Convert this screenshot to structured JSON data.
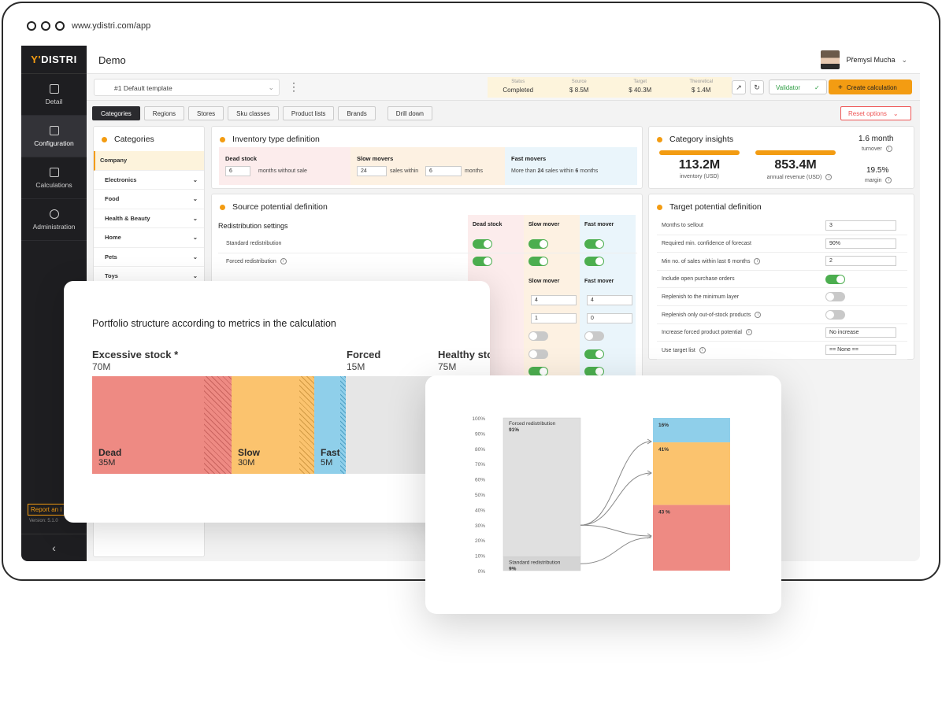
{
  "browser": {
    "url": "www.ydistri.com/app"
  },
  "sidebar": {
    "logo_prefix": "Y'",
    "logo_rest": "DISTRI",
    "items": [
      {
        "label": "Detail"
      },
      {
        "label": "Configuration"
      },
      {
        "label": "Calculations"
      },
      {
        "label": "Administration"
      }
    ],
    "report_label": "Report an i",
    "version": "Version: 5.1.0"
  },
  "header": {
    "title": "Demo",
    "user_name": "Přemysl Mucha"
  },
  "toolbar": {
    "template": "#1  Default template",
    "stats": [
      {
        "label": "Status",
        "value": "Completed"
      },
      {
        "label": "Source",
        "value": "$ 8.5M"
      },
      {
        "label": "Target",
        "value": "$ 40.3M"
      },
      {
        "label": "Theoretical",
        "value": "$ 1.4M"
      }
    ],
    "validator": "Validator",
    "create": "Create calculation"
  },
  "tabs": [
    "Categories",
    "Regions",
    "Stores",
    "Sku classes",
    "Product lists",
    "Brands",
    "Drill down"
  ],
  "reset_label": "Reset options",
  "categories": {
    "title": "Categories",
    "items": [
      "Company",
      "Electronics",
      "Food",
      "Health & Beauty",
      "Home",
      "Pets",
      "Toys"
    ]
  },
  "inventory": {
    "title": "Inventory type definition",
    "dead": {
      "label": "Dead stock",
      "value": "6",
      "suffix": "months without sale"
    },
    "slow": {
      "label": "Slow movers",
      "value1": "24",
      "mid": "sales within",
      "value2": "6",
      "suffix": "months"
    },
    "fast": {
      "label": "Fast movers",
      "prefix": "More than",
      "v1": "24",
      "mid": "sales within",
      "v2": "6",
      "suffix": "months"
    }
  },
  "insights": {
    "title": "Category insights",
    "inventory_value": "113.2M",
    "inventory_label": "inventory (USD)",
    "revenue_value": "853.4M",
    "revenue_label": "annual revenue (USD)",
    "turnover_value": "1.6 month",
    "turnover_label": "turnover",
    "margin_value": "19.5%",
    "margin_label": "margin"
  },
  "source": {
    "title": "Source potential definition",
    "subtitle": "Redistribution settings",
    "col_heads": [
      "Dead stock",
      "Slow mover",
      "Fast mover"
    ],
    "rows": [
      {
        "label": "Standard redistribution",
        "states": [
          true,
          true,
          true
        ]
      },
      {
        "label": "Forced redistribution",
        "states": [
          true,
          true,
          true
        ]
      }
    ],
    "inputs_row1": [
      "4",
      "4"
    ],
    "inputs_row2": [
      "1",
      "0"
    ],
    "extra_toggles": [
      [
        false,
        false
      ],
      [
        false,
        true
      ],
      [
        true,
        true
      ]
    ]
  },
  "target": {
    "title": "Target potential definition",
    "rows": [
      {
        "label": "Months to sellout",
        "value": "3"
      },
      {
        "label": "Required min. confidence of forecast",
        "value": "90%"
      },
      {
        "label": "Min no. of sales within last 6 months",
        "value": "2"
      },
      {
        "label": "Include open purchase orders",
        "toggle": true
      },
      {
        "label": "Replenish to the minimum layer",
        "toggle": false
      },
      {
        "label": "Replenish only out-of-stock products",
        "toggle": false
      },
      {
        "label": "Increase forced product potential",
        "value": "No increase"
      },
      {
        "label": "Use target list",
        "value": "== None =="
      }
    ]
  },
  "portfolio": {
    "title": "Portfolio structure according to metrics in the calculation",
    "groups": [
      {
        "label": "Excessive stock *",
        "value": "70M"
      },
      {
        "label": "Forced",
        "value": "15M"
      },
      {
        "label": "Healthy sto",
        "value": "75M"
      }
    ],
    "segments": [
      {
        "label": "Dead",
        "value": "35M"
      },
      {
        "label": "Slow",
        "value": "30M"
      },
      {
        "label": "Fast",
        "value": "5M"
      }
    ],
    "colors": {
      "dead": "#ee8a83",
      "slow": "#fbc36e",
      "fast": "#8fcfea",
      "healthy": "#e6e6e6"
    }
  },
  "chart_data": {
    "type": "bar",
    "yticks": [
      "100%",
      "90%",
      "80%",
      "70%",
      "60%",
      "50%",
      "40%",
      "30%",
      "20%",
      "10%",
      "0%"
    ],
    "source_bar": [
      {
        "label": "Forced redistribution",
        "value": 91,
        "value_label": "91%"
      },
      {
        "label": "Standard redistribution",
        "value": 9,
        "value_label": "9%"
      }
    ],
    "target_bar": [
      {
        "value": 16,
        "value_label": "16%",
        "color": "#8fcfea"
      },
      {
        "value": 41,
        "value_label": "41%",
        "color": "#fbc36e"
      },
      {
        "value": 43,
        "value_label": "43 %",
        "color": "#ee8a83"
      }
    ]
  }
}
